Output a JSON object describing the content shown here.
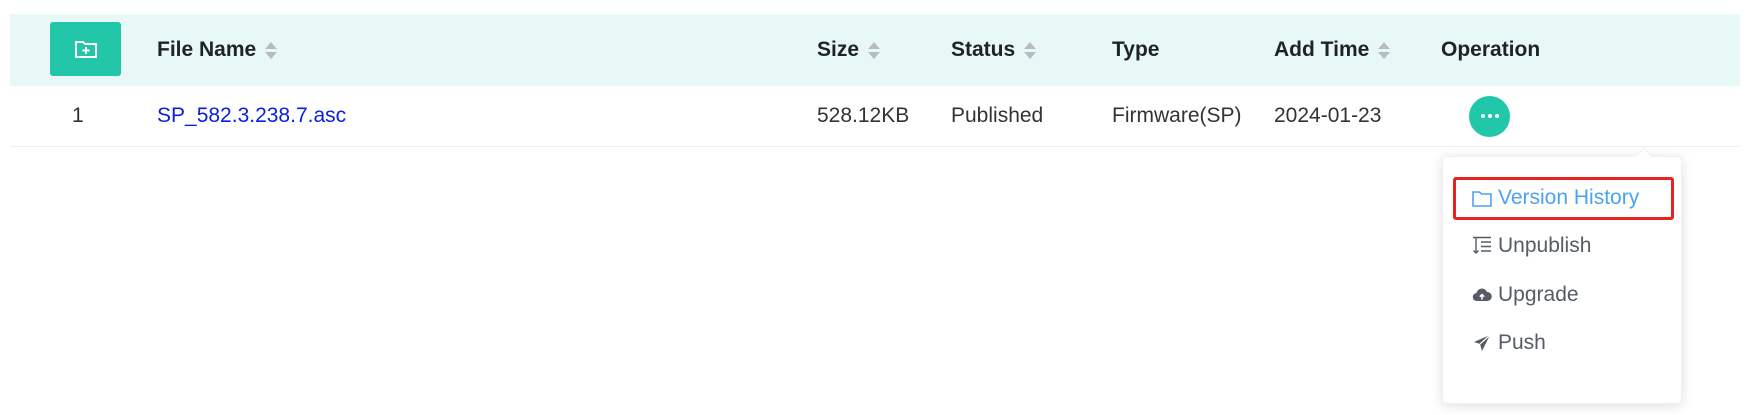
{
  "table": {
    "columns": {
      "file_name": "File Name",
      "size": "Size",
      "status": "Status",
      "type": "Type",
      "add_time": "Add Time",
      "operation": "Operation"
    },
    "add_button_icon": "folder-plus-icon",
    "rows": [
      {
        "index": "1",
        "file_name": "SP_582.3.238.7.asc",
        "size": "528.12KB",
        "status": "Published",
        "type": "Firmware(SP)",
        "add_time": "2024-01-23"
      }
    ]
  },
  "operation_menu": {
    "items": [
      {
        "label": "Version History",
        "icon": "folder-icon",
        "state": "highlighted"
      },
      {
        "label": "Unpublish",
        "icon": "sort-list-icon"
      },
      {
        "label": "Upgrade",
        "icon": "cloud-upload-icon"
      },
      {
        "label": "Push",
        "icon": "send-icon"
      }
    ]
  },
  "colors": {
    "accent": "#22c7a9",
    "header_bg": "#e8f8f6",
    "link": "#0a1ee0",
    "menu_active": "#4aa3f0",
    "highlight_border": "#e8231f"
  }
}
